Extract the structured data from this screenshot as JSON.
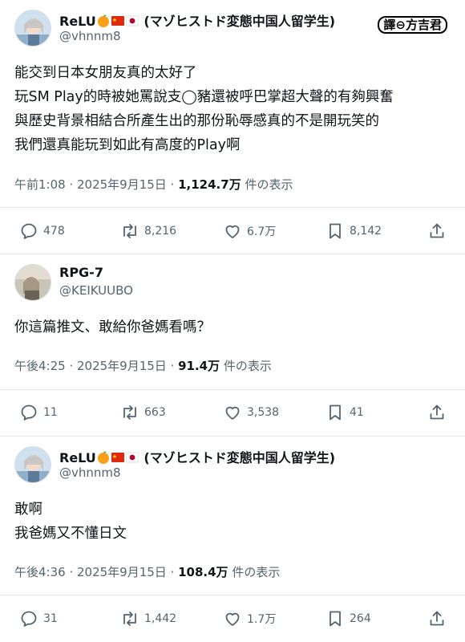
{
  "watermark": "譯⊖方吉君",
  "tweets": [
    {
      "name": "ReLU",
      "name_suffix": "(マゾヒストド変態中国人留学生)",
      "handle": "@vhnnm8",
      "lines": [
        "能交到日本女朋友真的太好了",
        "玩SM Play的時被她罵說支◯豬還被呼巴掌超大聲的有夠興奮",
        "與歷史背景相結合所產生出的那份恥辱感真的不是開玩笑的",
        "我們還真能玩到如此有高度的Play啊"
      ],
      "time": "午前1:08 · 2025年9月15日 · ",
      "views": "1,124.7万",
      "views_label": " 件の表示",
      "replies": "478",
      "retweets": "8,216",
      "likes": "6.7万",
      "bookmarks": "8,142"
    },
    {
      "name": "RPG-7",
      "name_suffix": "",
      "handle": "@KEIKUUBO",
      "lines": [
        "你這篇推文、敢給你爸媽看嗎？"
      ],
      "time": "午後4:25 · 2025年9月15日 · ",
      "views": "91.4万",
      "views_label": " 件の表示",
      "replies": "11",
      "retweets": "663",
      "likes": "3,538",
      "bookmarks": "41"
    },
    {
      "name": "ReLU",
      "name_suffix": "(マゾヒストド変態中国人留学生)",
      "handle": "@vhnnm8",
      "lines": [
        "敢啊",
        "我爸媽又不懂日文"
      ],
      "time": "午後4:36 · 2025年9月15日 · ",
      "views": "108.4万",
      "views_label": " 件の表示",
      "replies": "31",
      "retweets": "1,442",
      "likes": "1.7万",
      "bookmarks": "264"
    }
  ],
  "icons": {
    "reply": "reply-icon",
    "retweet": "retweet-icon",
    "like": "like-icon",
    "bookmark": "bookmark-icon",
    "share": "share-icon",
    "name_emojis": [
      "orange-emoji",
      "china-flag-emoji",
      "japan-flag-emoji"
    ]
  },
  "colors": {
    "text": "#0f1419",
    "secondary": "#536471",
    "divider": "#e6e9ec"
  }
}
